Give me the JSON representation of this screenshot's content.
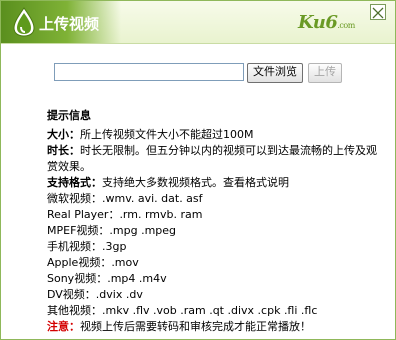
{
  "window": {
    "title": "上传视频",
    "brand": "Ku6",
    "brand_suffix": ".com",
    "icons": {
      "logo": "ku6-drop-logo",
      "close": "close-icon"
    },
    "colors": {
      "accent": "#6a9a25",
      "title_bg": "#7fb236",
      "note": "#d40000"
    }
  },
  "upload": {
    "file_value": "",
    "browse_label": "文件浏览",
    "upload_label": "上传"
  },
  "info": {
    "heading": "提示信息",
    "size_label": "大小：",
    "size_text": "所上传视频文件大小不能超过100M",
    "duration_label": "时长：",
    "duration_text": "时长无限制。但五分钟以内的视频可以到达最流畅的上传及观赏效果。",
    "formats_label": "支持格式：",
    "formats_text": "支持绝大多数视频格式。查看格式说明",
    "format_lines": [
      "微软视频：.wmv. avi. dat. asf",
      "Real Player：.rm. rmvb. ram",
      "MPEF视频：.mpg .mpeg",
      "手机视频：.3gp",
      "Apple视频：.mov",
      "Sony视频：.mp4 .m4v",
      "DV视频：.dvix .dv",
      "其他视频：.mkv .flv .vob .ram .qt .divx .cpk .fli .flc"
    ],
    "note_label": "注意：",
    "note_text": "视频上传后需要转码和审核完成才能正常播放！"
  }
}
